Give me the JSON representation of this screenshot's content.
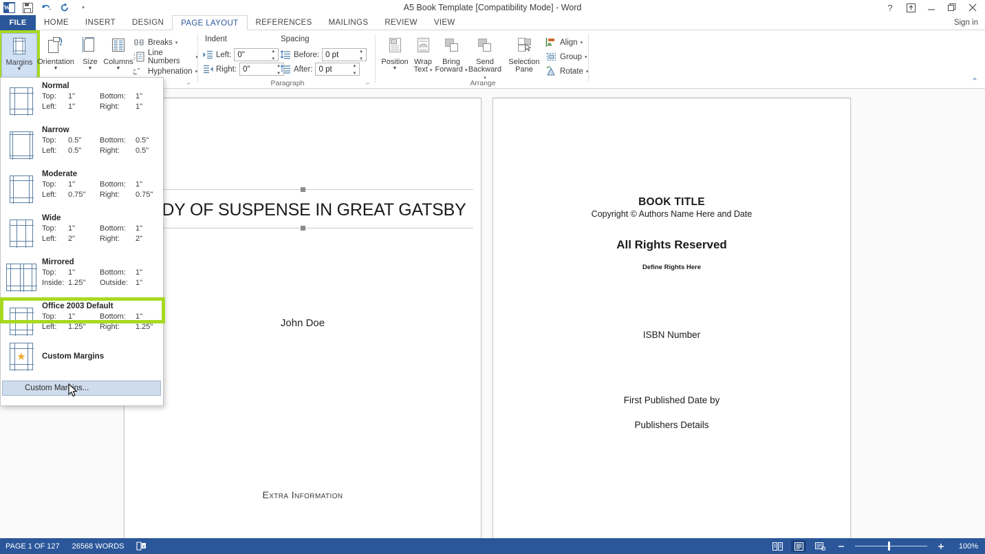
{
  "window": {
    "title": "A5 Book Template [Compatibility Mode] - Word",
    "sign_in": "Sign in",
    "help_icon": "help-icon",
    "ribbon_display_icon": "ribbon-display-options-icon",
    "minimize_icon": "minimize-icon",
    "restore_icon": "restore-icon",
    "close_icon": "close-icon"
  },
  "quick_access": {
    "word_logo": "word-logo-icon",
    "save": "save-icon",
    "undo": "undo-icon",
    "redo": "redo-icon",
    "customize": "customize-quick-access-icon"
  },
  "tabs": {
    "file": "FILE",
    "items": [
      {
        "label": "HOME",
        "active": false
      },
      {
        "label": "INSERT",
        "active": false
      },
      {
        "label": "DESIGN",
        "active": false
      },
      {
        "label": "PAGE LAYOUT",
        "active": true
      },
      {
        "label": "REFERENCES",
        "active": false
      },
      {
        "label": "MAILINGS",
        "active": false
      },
      {
        "label": "REVIEW",
        "active": false
      },
      {
        "label": "VIEW",
        "active": false
      }
    ]
  },
  "ribbon": {
    "page_setup": {
      "group_label": "",
      "margins": "Margins",
      "orientation": "Orientation",
      "size": "Size",
      "columns": "Columns",
      "breaks": "Breaks",
      "line_numbers": "Line Numbers",
      "hyphenation": "Hyphenation"
    },
    "paragraph": {
      "group_label": "Paragraph",
      "indent_header": "Indent",
      "spacing_header": "Spacing",
      "left_label": "Left:",
      "left_value": "0\"",
      "right_label": "Right:",
      "right_value": "0\"",
      "before_label": "Before:",
      "before_value": "0 pt",
      "after_label": "After:",
      "after_value": "0 pt"
    },
    "arrange": {
      "group_label": "Arrange",
      "position": "Position",
      "wrap_text_l1": "Wrap",
      "wrap_text_l2": "Text",
      "bring_forward_l1": "Bring",
      "bring_forward_l2": "Forward",
      "send_backward_l1": "Send",
      "send_backward_l2": "Backward",
      "selection_pane_l1": "Selection",
      "selection_pane_l2": "Pane",
      "align": "Align",
      "group": "Group",
      "rotate": "Rotate"
    },
    "collapse_icon": "collapse-ribbon-icon"
  },
  "margins_menu": {
    "presets": [
      {
        "name": "Normal",
        "top_label": "Top:",
        "top": "1\"",
        "bottom_label": "Bottom:",
        "bottom": "1\"",
        "left_label": "Left:",
        "left": "1\"",
        "right_label": "Right:",
        "right": "1\""
      },
      {
        "name": "Narrow",
        "top_label": "Top:",
        "top": "0.5\"",
        "bottom_label": "Bottom:",
        "bottom": "0.5\"",
        "left_label": "Left:",
        "left": "0.5\"",
        "right_label": "Right:",
        "right": "0.5\""
      },
      {
        "name": "Moderate",
        "top_label": "Top:",
        "top": "1\"",
        "bottom_label": "Bottom:",
        "bottom": "1\"",
        "left_label": "Left:",
        "left": "0.75\"",
        "right_label": "Right:",
        "right": "0.75\""
      },
      {
        "name": "Wide",
        "top_label": "Top:",
        "top": "1\"",
        "bottom_label": "Bottom:",
        "bottom": "1\"",
        "left_label": "Left:",
        "left": "2\"",
        "right_label": "Right:",
        "right": "2\""
      },
      {
        "name": "Mirrored",
        "top_label": "Top:",
        "top": "1\"",
        "bottom_label": "Bottom:",
        "bottom": "1\"",
        "left_label": "Inside:",
        "left": "1.25\"",
        "right_label": "Outside:",
        "right": "1\""
      },
      {
        "name": "Office 2003 Default",
        "top_label": "Top:",
        "top": "1\"",
        "bottom_label": "Bottom:",
        "bottom": "1\"",
        "left_label": "Left:",
        "left": "1.25\"",
        "right_label": "Right:",
        "right": "1.25\""
      }
    ],
    "custom_header": "Custom Margins",
    "custom_item": "Custom Margins...",
    "highlight_color": "#a8d921"
  },
  "document": {
    "left_page": {
      "title": "TUDY OF SUSPENSE IN GREAT GATSBY",
      "author": "John Doe",
      "extra": "Extra Information"
    },
    "right_page": {
      "book_title": "BOOK TITLE",
      "copyright": "Copyright © Authors Name Here and Date",
      "rights": "All Rights Reserved",
      "define_rights": "Define Rights Here",
      "isbn": "ISBN Number",
      "published": "First Published Date by",
      "publisher": "Publishers Details"
    }
  },
  "status_bar": {
    "page": "PAGE 1 OF 127",
    "words": "26568 WORDS",
    "proofing_icon": "proofing-errors-icon",
    "read_mode_icon": "read-mode-icon",
    "print_layout_icon": "print-layout-icon",
    "web_layout_icon": "web-layout-icon",
    "zoom_out_icon": "zoom-out-icon",
    "zoom_in_icon": "zoom-in-icon",
    "zoom_value": "100%",
    "accent_color": "#2b579a"
  }
}
